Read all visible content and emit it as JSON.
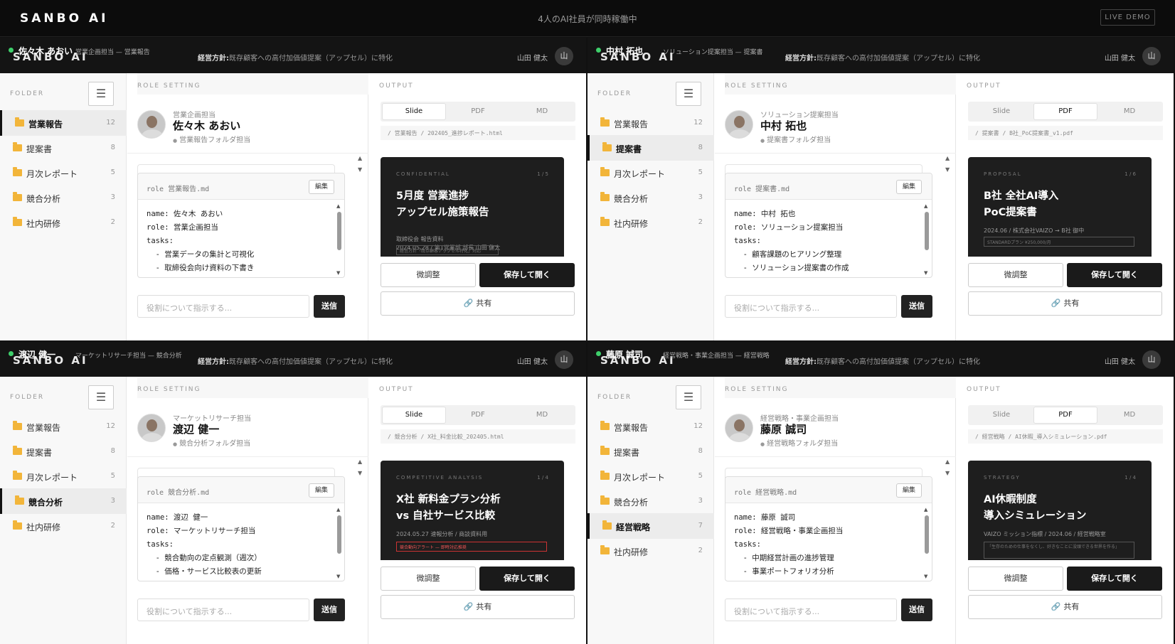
{
  "app": {
    "brand": "SANBO AI",
    "status": "4人のAI社員が同時稼働中",
    "demo": "LIVE DEMO"
  },
  "common": {
    "brand_ghost": "SANBO AI",
    "policy_label": "経営方針:",
    "policy_text": "既存顧客への高付加価値提案（アップセル）に特化",
    "user_name": "山田 健太",
    "user_initial": "山",
    "folder_title": "FOLDER",
    "menu_icon": "☰",
    "role_title": "ROLE SETTING",
    "edit_label": "編集",
    "instruct_placeholder": "役割について指示する...",
    "send_label": "送信",
    "output_title": "OUTPUT",
    "tabs": [
      "Slide",
      "PDF",
      "MD"
    ],
    "adjust_label": "微調整",
    "save_label": "保存して開く",
    "share_label": "共有",
    "folders": [
      {
        "label": "営業報告",
        "count": "12"
      },
      {
        "label": "提案書",
        "count": "8"
      },
      {
        "label": "月次レポート",
        "count": "5"
      },
      {
        "label": "競合分析",
        "count": "3"
      },
      {
        "label": "社内研修",
        "count": "2"
      }
    ]
  },
  "panels": [
    {
      "name": "佐々木 あおい",
      "role": "営業企画担当 — 営業報告",
      "sub": "営業企画担当",
      "folder_note": "営業報告フォルダ担当",
      "md_file": "role 営業報告.md",
      "md": [
        "name: 佐々木 あおい",
        "role: 営業企画担当",
        "tasks:",
        "  - 営業データの集計と可視化",
        "  - 取締役会向け資料の下書き"
      ],
      "path": "/ 営業報告 / 202405_進捗レポート.html",
      "slide": {
        "kicker": "CONFIDENTIAL",
        "page": "1 / 5",
        "title": "5月度 営業進捗\nアップセル施策報告",
        "meta": "取締役会 報告資料\n2024.05.28 / 第1営業部 部長 山田 健太",
        "note": "経営方針「既存顧客アップセル特化」対応"
      }
    },
    {
      "name": "中村 拓也",
      "role": "ソリューション提案担当 — 提案書",
      "sub": "ソリューション提案担当",
      "folder_note": "提案書フォルダ担当",
      "md_file": "role 提案書.md",
      "md": [
        "name: 中村 拓也",
        "role: ソリューション提案担当",
        "tasks:",
        "  - 顧客課題のヒアリング整理",
        "  - ソリューション提案書の作成"
      ],
      "path": "/ 提案書 / B社_PoC提案書_v1.pdf",
      "slide": {
        "kicker": "PROPOSAL",
        "page": "1 / 6",
        "title": "B社 全社AI導入\nPoC提案書",
        "meta": "2024.06 / 株式会社VAIZO → B社 御中",
        "note": "STANDARDプラン ¥250,000/月"
      }
    },
    {
      "name": "渡辺 健一",
      "role": "マーケットリサーチ担当 — 競合分析",
      "sub": "マーケットリサーチ担当",
      "folder_note": "競合分析フォルダ担当",
      "md_file": "role 競合分析.md",
      "md": [
        "name: 渡辺 健一",
        "role: マーケットリサーチ担当",
        "tasks:",
        "  - 競合動向の定点観測（週次）",
        "  - 価格・サービス比較表の更新"
      ],
      "path": "/ 競合分析 / X社_料金比較_202405.html",
      "slide": {
        "kicker": "COMPETITIVE ANALYSIS",
        "page": "1 / 4",
        "title": "X社 新料金プラン分析\nvs 自社サービス比較",
        "meta": "2024.05.27 速報分析 / 商談資料用",
        "note": "競合動向アラート — 即時対応推奨"
      }
    },
    {
      "name": "藤原 誠司",
      "role": "経営戦略・事業企画担当 — 経営戦略",
      "sub": "経営戦略・事業企画担当",
      "folder_note": "経営戦略フォルダ担当",
      "md_file": "role 経営戦略.md",
      "md": [
        "name: 藤原 誠司",
        "role: 経営戦略・事業企画担当",
        "tasks:",
        "  - 中期経営計画の進捗管理",
        "  - 事業ポートフォリオ分析"
      ],
      "path": "/ 経営戦略 / AI休暇_導入シミュレーション.pdf",
      "slide": {
        "kicker": "STRATEGY",
        "page": "1 / 4",
        "title": "AI休暇制度\n導入シミュレーション",
        "meta": "VAIZO ミッション指標 / 2024.06 / 経営戦略室",
        "note": "「生存のための仕事をなくし、好きなことに没頭できる世界を作る」"
      },
      "extra_folder": {
        "label": "経営戦略",
        "count": "7"
      }
    }
  ]
}
